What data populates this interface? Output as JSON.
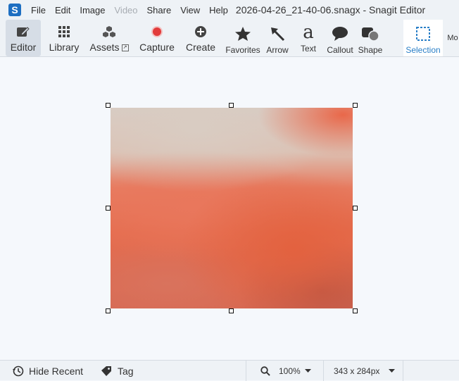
{
  "app": {
    "logo_letter": "S",
    "window_title": "2026-04-26_21-40-06.snagx - Snagit Editor"
  },
  "menu": {
    "items": [
      {
        "label": "File",
        "enabled": true
      },
      {
        "label": "Edit",
        "enabled": true
      },
      {
        "label": "Image",
        "enabled": true
      },
      {
        "label": "Video",
        "enabled": false
      },
      {
        "label": "Share",
        "enabled": true
      },
      {
        "label": "View",
        "enabled": true
      },
      {
        "label": "Help",
        "enabled": true
      }
    ]
  },
  "toolbar": {
    "editor": "Editor",
    "library": "Library",
    "assets": "Assets",
    "assets_badge": "↗",
    "capture": "Capture",
    "create": "Create",
    "favorites": "Favorites",
    "arrow": "Arrow",
    "text": "Text",
    "text_glyph": "a",
    "callout": "Callout",
    "shape": "Shape",
    "selection": "Selection",
    "more_truncated": "Mo"
  },
  "status": {
    "hide_recent": "Hide Recent",
    "tag": "Tag",
    "zoom": "100%",
    "dimensions": "343 x 284px"
  },
  "colors": {
    "capture_red": "#e23b3b",
    "accent_blue": "#2a7fc7"
  }
}
